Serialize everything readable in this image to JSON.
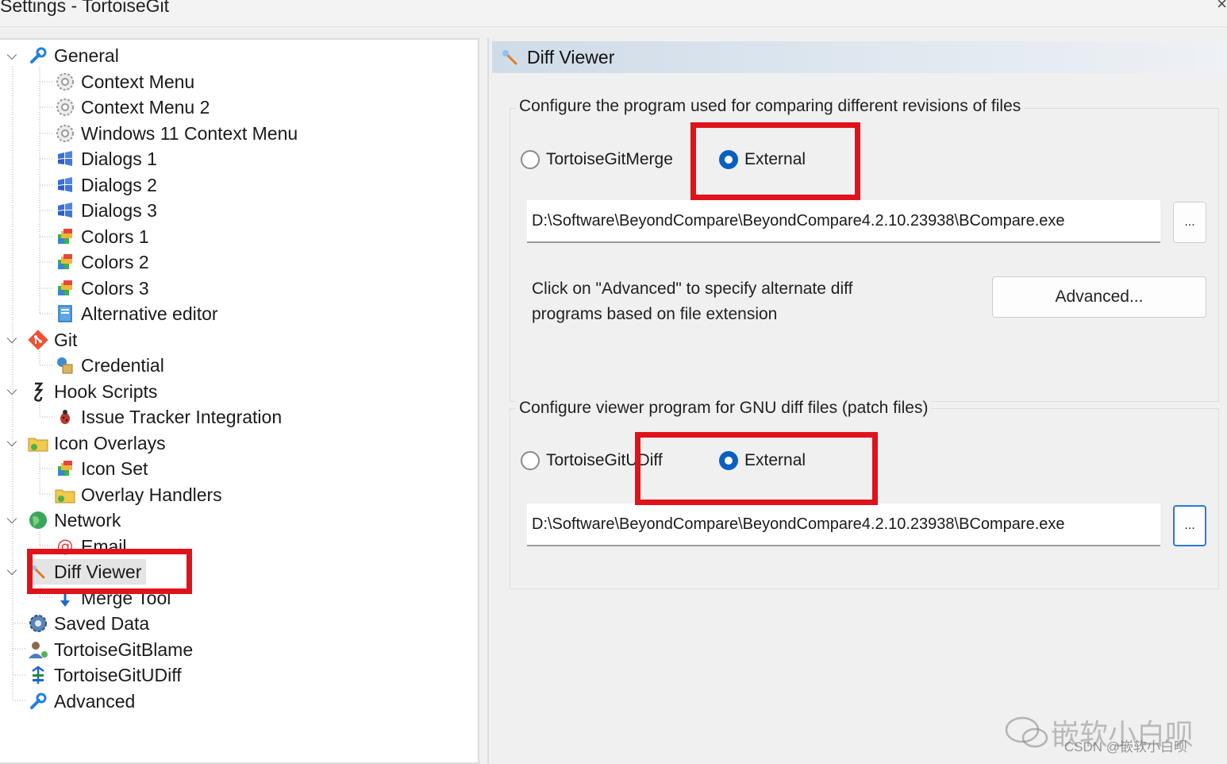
{
  "window": {
    "title": "Settings - TortoiseGit",
    "close_glyph": "×"
  },
  "tree": {
    "items": [
      {
        "label": "General",
        "icon": "wrench-icon"
      },
      {
        "label": "Context Menu",
        "icon": "gear-icon"
      },
      {
        "label": "Context Menu 2",
        "icon": "gear-icon"
      },
      {
        "label": "Windows 11 Context Menu",
        "icon": "gear-icon"
      },
      {
        "label": "Dialogs 1",
        "icon": "windows-icon"
      },
      {
        "label": "Dialogs 2",
        "icon": "windows-icon"
      },
      {
        "label": "Dialogs 3",
        "icon": "windows-icon"
      },
      {
        "label": "Colors 1",
        "icon": "palette-icon"
      },
      {
        "label": "Colors 2",
        "icon": "palette-icon"
      },
      {
        "label": "Colors 3",
        "icon": "palette-icon"
      },
      {
        "label": "Alternative editor",
        "icon": "document-icon"
      },
      {
        "label": "Git",
        "icon": "git-icon"
      },
      {
        "label": "Credential",
        "icon": "key-icon"
      },
      {
        "label": "Hook Scripts",
        "icon": "hook-icon"
      },
      {
        "label": "Issue Tracker Integration",
        "icon": "bug-icon"
      },
      {
        "label": "Icon Overlays",
        "icon": "folder-overlay-icon"
      },
      {
        "label": "Icon Set",
        "icon": "palette-icon"
      },
      {
        "label": "Overlay Handlers",
        "icon": "folder-overlay-icon"
      },
      {
        "label": "Network",
        "icon": "globe-icon"
      },
      {
        "label": "Email",
        "icon": "at-sign-icon"
      },
      {
        "label": "Diff Viewer",
        "icon": "magnifier-icon"
      },
      {
        "label": "Merge Tool",
        "icon": "merge-arrow-icon"
      },
      {
        "label": "Saved Data",
        "icon": "gear-cog-icon"
      },
      {
        "label": "TortoiseGitBlame",
        "icon": "blame-user-icon"
      },
      {
        "label": "TortoiseGitUDiff",
        "icon": "udiff-icon"
      },
      {
        "label": "Advanced",
        "icon": "wrench-icon"
      }
    ],
    "selected": "Diff Viewer"
  },
  "page": {
    "header_title": "Diff Viewer",
    "header_icon": "magnifier-icon",
    "diff_group": {
      "title": "Configure the program used for comparing different revisions of files",
      "option_internal": "TortoiseGitMerge",
      "option_external": "External",
      "selected": "External",
      "path_value": "D:\\Software\\BeyondCompare\\BeyondCompare4.2.10.23938\\BCompare.exe",
      "browse_label": "...",
      "advanced_hint_line1": "Click on \"Advanced\" to specify alternate diff",
      "advanced_hint_line2": "programs based on file extension",
      "advanced_button": "Advanced..."
    },
    "patch_group": {
      "title": "Configure viewer program for GNU diff files (patch files)",
      "option_internal": "TortoiseGitUDiff",
      "option_external": "External",
      "selected": "External",
      "path_value": "D:\\Software\\BeyondCompare\\BeyondCompare4.2.10.23938\\BCompare.exe",
      "browse_label": "..."
    }
  },
  "watermark": {
    "main": "嵌软小白呗",
    "sub": "CSDN @嵌软小白呗"
  },
  "colors": {
    "highlight": "#e0121b",
    "radio_accent": "#0a5fc2",
    "header_grad_start": "#cfdbe8"
  }
}
